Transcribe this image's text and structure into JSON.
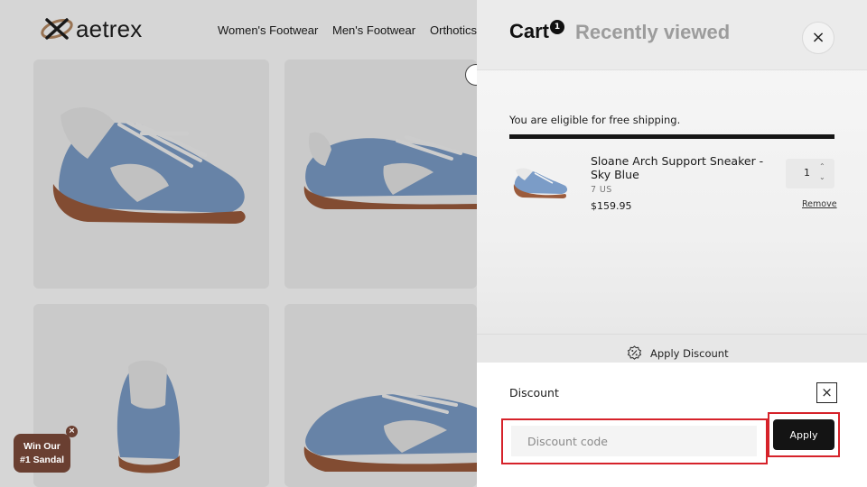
{
  "header": {
    "logo_text": "aetrex",
    "nav": [
      "Women's Footwear",
      "Men's Footwear",
      "Orthotics"
    ]
  },
  "promo": {
    "label_line1": "Win Our",
    "label_line2": "#1 Sandal",
    "close_glyph": "×"
  },
  "drawer": {
    "tabs": {
      "cart": "Cart",
      "cart_count": "1",
      "recent": "Recently viewed"
    },
    "close_glyph": "×",
    "shipping_message": "You are eligible for free shipping.",
    "item": {
      "name": "Sloane Arch Support Sneaker - Sky Blue",
      "variant": "7 US",
      "price": "$159.95",
      "quantity": "1",
      "remove_label": "Remove"
    },
    "apply_discount_label": "Apply Discount",
    "discount": {
      "title": "Discount",
      "close_glyph": "×",
      "input_placeholder": "Discount code",
      "input_value": "",
      "apply_label": "Apply"
    }
  },
  "colors": {
    "shoe_blue": "#7b9cc7",
    "shoe_sole": "#9b5b3c",
    "promo_brown": "#6a3f31",
    "highlight_red": "#d6222a"
  }
}
